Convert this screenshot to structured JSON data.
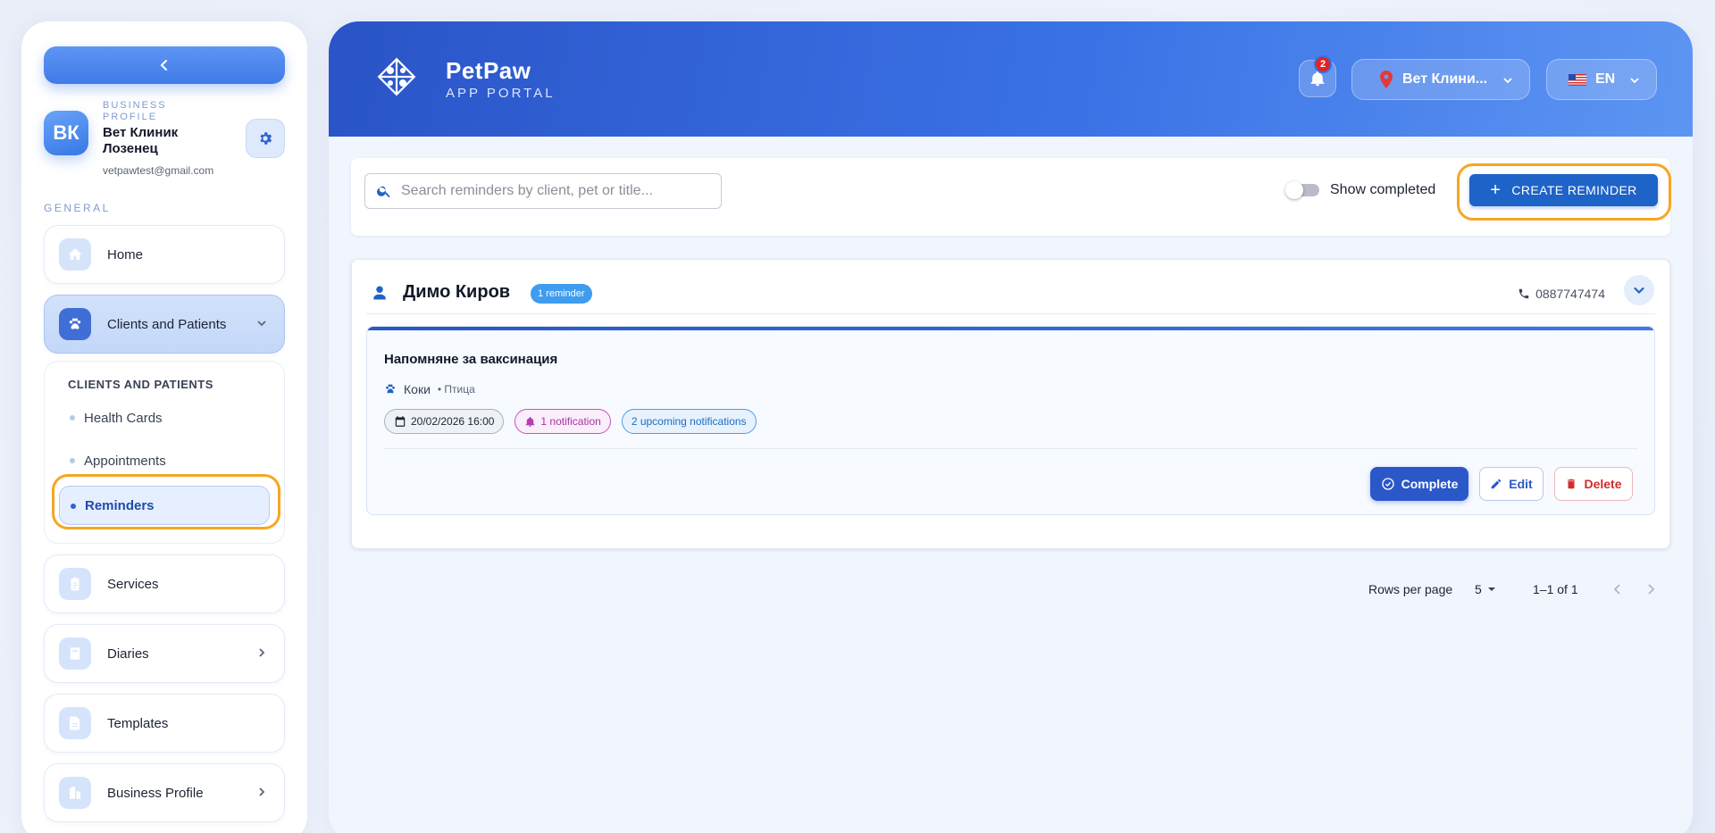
{
  "sidebar": {
    "collapse_icon": "chevron-left-icon",
    "profile": {
      "initials": "ВК",
      "kicker": "BUSINESS PROFILE",
      "name": "Вет Клиник Лозенец",
      "email": "vetpawtest@gmail.com"
    },
    "section_label": "GENERAL",
    "items": [
      {
        "label": "Home",
        "icon": "home-icon"
      },
      {
        "label": "Clients and Patients",
        "icon": "paw-icon",
        "expanded": true
      },
      {
        "label": "Services",
        "icon": "clipboard-icon"
      },
      {
        "label": "Diaries",
        "icon": "book-icon"
      },
      {
        "label": "Templates",
        "icon": "document-icon"
      },
      {
        "label": "Business Profile",
        "icon": "building-icon"
      }
    ],
    "submenu": {
      "title": "CLIENTS AND PATIENTS",
      "items": [
        {
          "label": "Health Cards"
        },
        {
          "label": "Appointments"
        },
        {
          "label": "Reminders",
          "selected": true
        }
      ]
    }
  },
  "header": {
    "brand_name": "PetPaw",
    "brand_sub": "APP PORTAL",
    "notification_count": "2",
    "clinic_select": "Вет Клини...",
    "language": "EN"
  },
  "toolbar": {
    "search_placeholder": "Search reminders by client, pet or title...",
    "search_value": "",
    "show_completed_label": "Show completed",
    "show_completed": false,
    "create_label": "CREATE REMINDER"
  },
  "clients": [
    {
      "name": "Димо Киров",
      "reminder_count": "1 reminder",
      "phone": "0887747474",
      "reminders": [
        {
          "title": "Напомняне за ваксинация",
          "pet_name": "Коки",
          "pet_species": "• Птица",
          "date": "20/02/2026 16:00",
          "notification": "1 notification",
          "upcoming": "2 upcoming notifications",
          "actions": {
            "complete": "Complete",
            "edit": "Edit",
            "delete": "Delete"
          }
        }
      ]
    }
  ],
  "pagination": {
    "rows_label": "Rows per page",
    "rows_value": "5",
    "range": "1–1 of 1"
  },
  "colors": {
    "accent": "#1e63c7",
    "highlight": "#f6a623",
    "danger": "#d22c2c"
  }
}
